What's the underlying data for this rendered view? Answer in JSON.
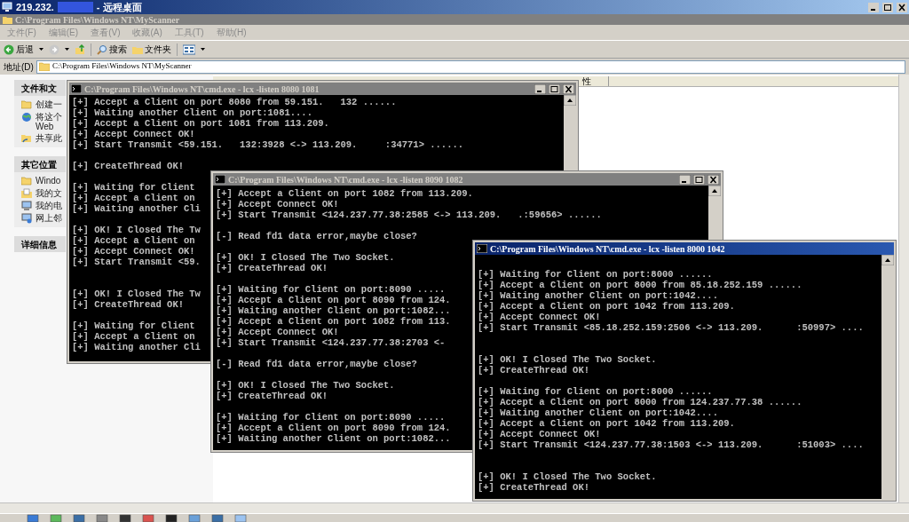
{
  "remote_desktop": {
    "title_host": "219.232.",
    "title_suffix": "- 远程桌面"
  },
  "explorer": {
    "title": "C:\\Program Files\\Windows NT\\MyScanner",
    "menu": [
      "文件(F)",
      "编辑(E)",
      "查看(V)",
      "收藏(A)",
      "工具(T)",
      "帮助(H)"
    ],
    "toolbar": [
      {
        "kind": "back",
        "label": "后退"
      },
      {
        "kind": "forward"
      },
      {
        "kind": "up"
      },
      {
        "kind": "search",
        "label": "搜索"
      },
      {
        "kind": "folders",
        "label": "文件夹"
      },
      {
        "kind": "views"
      }
    ],
    "address": {
      "label": "地址(D)",
      "value": "C:\\Program Files\\Windows NT\\MyScanner"
    },
    "task_pane": [
      {
        "title": "文件和文",
        "items": [
          {
            "kind": "folder",
            "lines": [
              "创建一"
            ]
          },
          {
            "kind": "globe",
            "lines": [
              "将这个",
              "Web"
            ]
          },
          {
            "kind": "share",
            "lines": [
              "共享此"
            ]
          }
        ]
      },
      {
        "title": "其它位置",
        "items": [
          {
            "kind": "folder",
            "lines": [
              "Windo"
            ]
          },
          {
            "kind": "docs",
            "lines": [
              "我的文"
            ]
          },
          {
            "kind": "computer",
            "lines": [
              "我的电"
            ]
          },
          {
            "kind": "network",
            "lines": [
              "网上邻"
            ]
          }
        ]
      },
      {
        "title": "详细信息"
      }
    ],
    "column_header": "性"
  },
  "consoles": [
    {
      "title": "C:\\Program Files\\Windows NT\\cmd.exe - lcx -listen 8080 1081",
      "active": false,
      "show_controls": true,
      "lines": [
        {
          "kind": "text",
          "text": "[+] Accept a Client on port 8080 from 59.151.   132 ......"
        },
        {
          "kind": "text",
          "text": "[+] Waiting another Client on port:1081...."
        },
        {
          "kind": "text",
          "text": "[+] Accept a Client on port 1081 from 113.209."
        },
        {
          "kind": "text",
          "text": "[+] Accept Connect OK!"
        },
        {
          "kind": "text",
          "text": "[+] Start Transmit <59.151.   132:3928 <-> 113.209.     :34771> ......"
        },
        {
          "kind": "blank"
        },
        {
          "kind": "text",
          "text": "[+] CreateThread OK!"
        },
        {
          "kind": "blank"
        },
        {
          "kind": "text",
          "text": "[+] Waiting for Client"
        },
        {
          "kind": "text",
          "text": "[+] Accept a Client on"
        },
        {
          "kind": "text",
          "text": "[+] Waiting another Cli"
        },
        {
          "kind": "blank"
        },
        {
          "kind": "text",
          "text": "[+] OK! I Closed The Tw"
        },
        {
          "kind": "text",
          "text": "[+] Accept a Client on"
        },
        {
          "kind": "text",
          "text": "[+] Accept Connect OK!"
        },
        {
          "kind": "text",
          "text": "[+] Start Transmit <59."
        },
        {
          "kind": "blank"
        },
        {
          "kind": "blank"
        },
        {
          "kind": "text",
          "text": "[+] OK! I Closed The Tw"
        },
        {
          "kind": "text",
          "text": "[+] CreateThread OK!"
        },
        {
          "kind": "blank"
        },
        {
          "kind": "text",
          "text": "[+] Waiting for Client"
        },
        {
          "kind": "text",
          "text": "[+] Accept a Client on"
        },
        {
          "kind": "text",
          "text": "[+] Waiting another Cli"
        }
      ]
    },
    {
      "title": "C:\\Program Files\\Windows NT\\cmd.exe - lcx -listen 8090 1082",
      "active": false,
      "show_controls": true,
      "lines": [
        {
          "kind": "text",
          "text": "[+] Accept a Client on port 1082 from 113.209."
        },
        {
          "kind": "text",
          "text": "[+] Accept Connect OK!"
        },
        {
          "kind": "text",
          "text": "[+] Start Transmit <124.237.77.38:2585 <-> 113.209.   .:59656> ......"
        },
        {
          "kind": "blank"
        },
        {
          "kind": "text",
          "text": "[-] Read fd1 data error,maybe close?"
        },
        {
          "kind": "blank"
        },
        {
          "kind": "text",
          "text": "[+] OK! I Closed The Two Socket."
        },
        {
          "kind": "text",
          "text": "[+] CreateThread OK!"
        },
        {
          "kind": "blank"
        },
        {
          "kind": "text",
          "text": "[+] Waiting for Client on port:8090 ....."
        },
        {
          "kind": "text",
          "text": "[+] Accept a Client on port 8090 from 124."
        },
        {
          "kind": "text",
          "text": "[+] Waiting another Client on port:1082..."
        },
        {
          "kind": "text",
          "text": "[+] Accept a Client on port 1082 from 113."
        },
        {
          "kind": "text",
          "text": "[+] Accept Connect OK!"
        },
        {
          "kind": "text",
          "text": "[+] Start Transmit <124.237.77.38:2703 <-"
        },
        {
          "kind": "blank"
        },
        {
          "kind": "text",
          "text": "[-] Read fd1 data error,maybe close?"
        },
        {
          "kind": "blank"
        },
        {
          "kind": "text",
          "text": "[+] OK! I Closed The Two Socket."
        },
        {
          "kind": "text",
          "text": "[+] CreateThread OK!"
        },
        {
          "kind": "blank"
        },
        {
          "kind": "text",
          "text": "[+] Waiting for Client on port:8090 ....."
        },
        {
          "kind": "text",
          "text": "[+] Accept a Client on port 8090 from 124."
        },
        {
          "kind": "text",
          "text": "[+] Waiting another Client on port:1082..."
        }
      ]
    },
    {
      "title": "C:\\Program Files\\Windows NT\\cmd.exe - lcx -listen 8000 1042",
      "active": true,
      "show_controls": false,
      "lines": [
        {
          "kind": "blank"
        },
        {
          "kind": "text",
          "text": "[+] Waiting for Client on port:8000 ......"
        },
        {
          "kind": "text",
          "text": "[+] Accept a Client on port 8000 from 85.18.252.159 ......"
        },
        {
          "kind": "text",
          "text": "[+] Waiting another Client on port:1042...."
        },
        {
          "kind": "text",
          "text": "[+] Accept a Client on port 1042 from 113.209."
        },
        {
          "kind": "text",
          "text": "[+] Accept Connect OK!"
        },
        {
          "kind": "text",
          "text": "[+] Start Transmit <85.18.252.159:2506 <-> 113.209.      :50997> ...."
        },
        {
          "kind": "blank"
        },
        {
          "kind": "blank"
        },
        {
          "kind": "text",
          "text": "[+] OK! I Closed The Two Socket."
        },
        {
          "kind": "text",
          "text": "[+] CreateThread OK!"
        },
        {
          "kind": "blank"
        },
        {
          "kind": "text",
          "text": "[+] Waiting for Client on port:8000 ......"
        },
        {
          "kind": "text",
          "text": "[+] Accept a Client on port 8000 from 124.237.77.38 ......"
        },
        {
          "kind": "text",
          "text": "[+] Waiting another Client on port:1042...."
        },
        {
          "kind": "text",
          "text": "[+] Accept a Client on port 1042 from 113.209."
        },
        {
          "kind": "text",
          "text": "[+] Accept Connect OK!"
        },
        {
          "kind": "text",
          "text": "[+] Start Transmit <124.237.77.38:1503 <-> 113.209.      :51003> ...."
        },
        {
          "kind": "blank"
        },
        {
          "kind": "blank"
        },
        {
          "kind": "text",
          "text": "[+] OK! I Closed The Two Socket."
        },
        {
          "kind": "text",
          "text": "[+] CreateThread OK!"
        }
      ]
    }
  ],
  "taskbar": [
    {
      "kind": "app"
    },
    {
      "kind": "app"
    },
    {
      "kind": "app"
    },
    {
      "kind": "app"
    },
    {
      "kind": "app"
    },
    {
      "kind": "app"
    },
    {
      "kind": "app"
    },
    {
      "kind": "app"
    },
    {
      "kind": "app"
    },
    {
      "kind": "app"
    }
  ]
}
